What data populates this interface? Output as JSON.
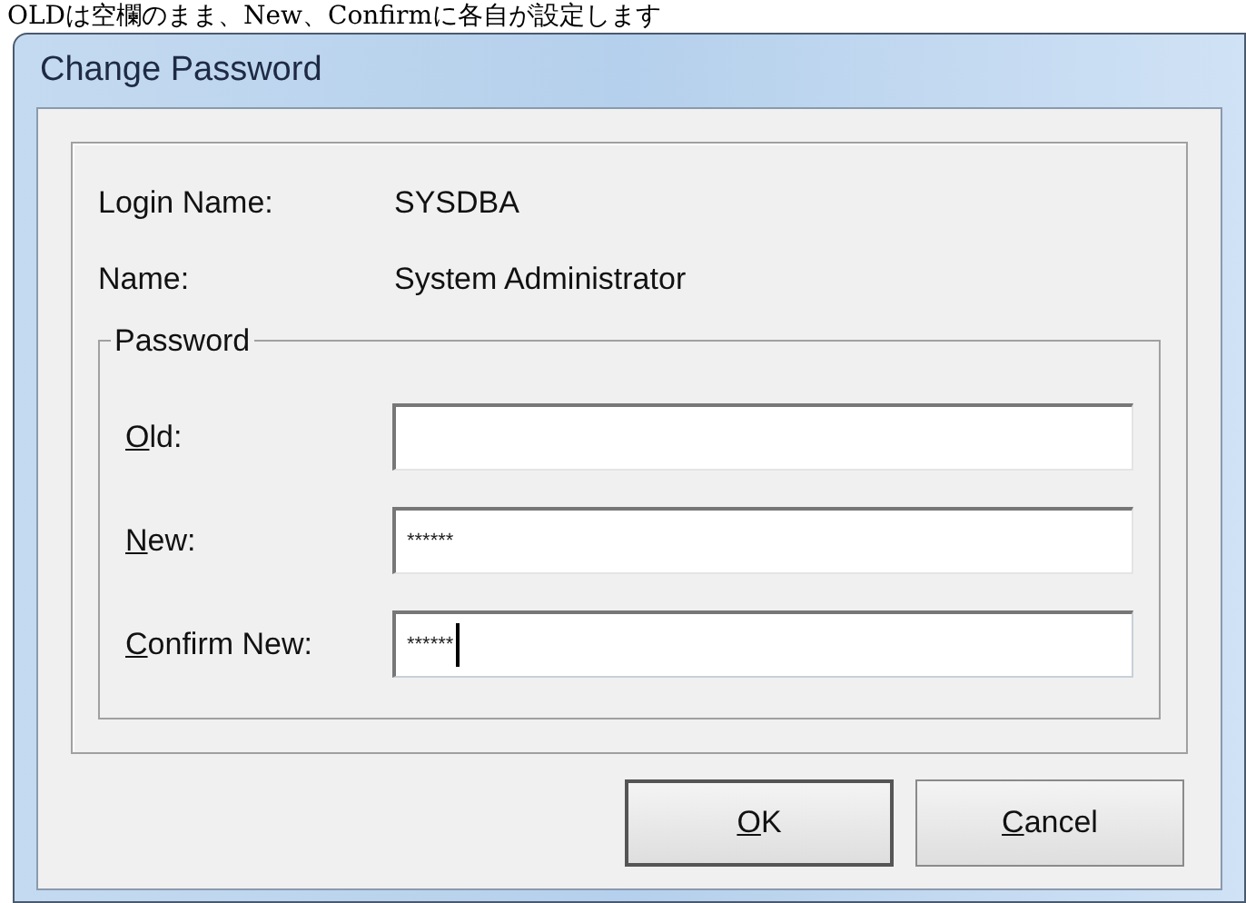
{
  "note": "OLDは空欄のまま、New、Confirmに各自が設定します",
  "window": {
    "title": "Change Password"
  },
  "info": [
    {
      "label": "Login Name:",
      "value": "SYSDBA"
    },
    {
      "label": "Name:",
      "value": "System Administrator"
    }
  ],
  "password_group": {
    "title": "Password",
    "fields": [
      {
        "label": "Old:",
        "focused": false
      },
      {
        "label": "New:",
        "value": "******",
        "focused": false
      },
      {
        "label": "Confirm New:",
        "value": "******",
        "focused": true
      }
    ]
  },
  "buttons": [
    {
      "label": "OK",
      "default": true
    },
    {
      "label": "Cancel",
      "default": false
    }
  ]
}
